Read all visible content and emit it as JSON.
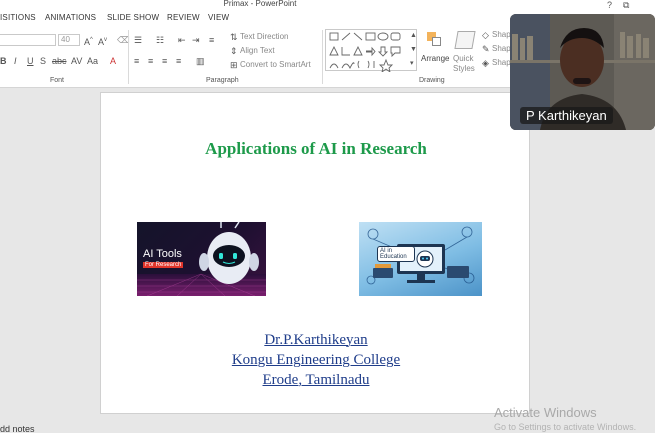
{
  "window": {
    "title": "Primax - PowerPoint",
    "help": "?",
    "restore": "⧉",
    "minimize": "–",
    "close": "✕"
  },
  "tabs": [
    "ISITIONS",
    "ANIMATIONS",
    "SLIDE SHOW",
    "REVIEW",
    "VIEW"
  ],
  "ribbon": {
    "font_size": "40",
    "groups": {
      "font": "Font",
      "paragraph": "Paragraph",
      "drawing": "Drawing"
    },
    "paragraph": {
      "text_direction": "Text Direction",
      "align_text": "Align Text",
      "convert_smartart": "Convert to SmartArt"
    },
    "drawing": {
      "arrange": "Arrange",
      "quick_styles_1": "Quick",
      "quick_styles_2": "Styles",
      "shape_fill": "Shap",
      "shape_outline": "Shap",
      "shape_effects": "Shap"
    }
  },
  "slide": {
    "title": "Applications of AI in Research",
    "image1": {
      "line1": "AI Tools",
      "line2": "For Research"
    },
    "image2": {
      "line1": "AI in",
      "line2": "Education"
    },
    "author": [
      "Dr.P.Karthikeyan",
      "Kongu Engineering College",
      "Erode, Tamilnadu"
    ]
  },
  "status": {
    "notes": "dd notes"
  },
  "watermark": {
    "line1": "Activate Windows",
    "line2": "Go to Settings to activate Windows."
  },
  "video": {
    "name": "P Karthikeyan"
  },
  "colors": {
    "title_green": "#1d9a4a",
    "author_blue": "#1f3d8a",
    "ribbon_bg": "#ffffff",
    "workspace_bg": "#e7e7e7"
  }
}
